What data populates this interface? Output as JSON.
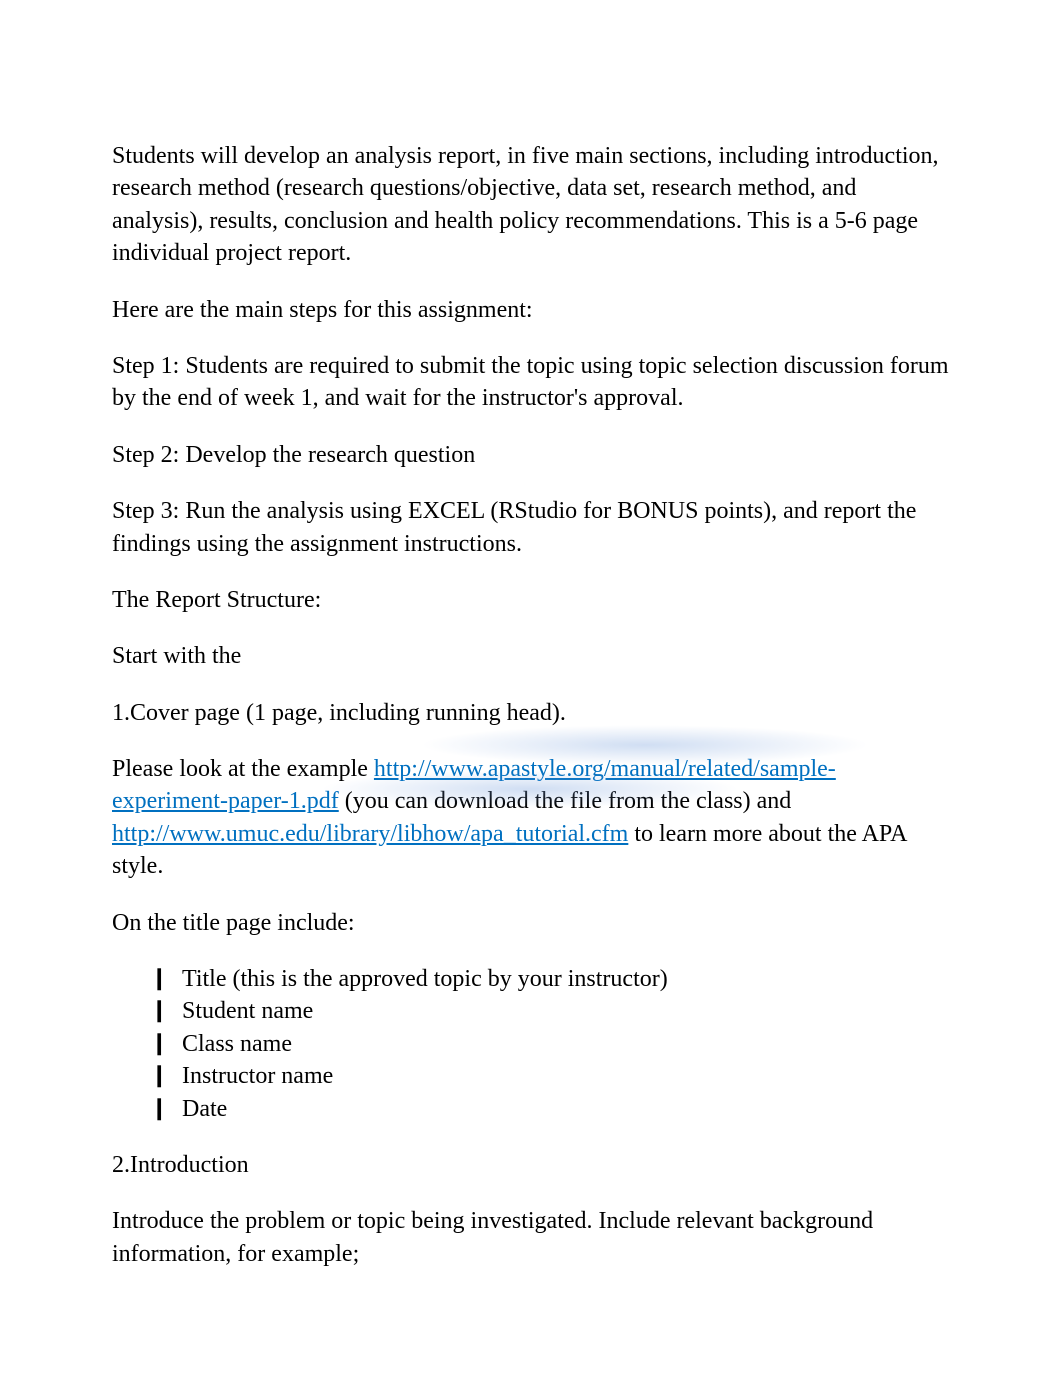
{
  "para1": {
    "part1": "Students will develop an analysis report, in five main sections, including  introduction, ",
    "part2": "research method (research questions/objective, data set, research method, and analysis), results, conclusion and ",
    "part3": "health policy recommendations",
    "part4": ". This is a 5-6 page individual project report."
  },
  "para2": "Here are the main steps for this assignment:",
  "step1": "Step 1:   Students are required to submit the topic using topic selection discussion forum by the end of week 1, and wait for the instructor's approval.",
  "step2": "Step 2:   Develop the research question",
  "step3": "Step 3:    Run the analysis using EXCEL (RStudio for BONUS points), and report the findings using the assignment instructions.",
  "reportStructure": "The Report Structure:",
  "startWith": "Start with the",
  "cover": {
    "num": "1.",
    "label": "Cover page",
    "rest": "    (1 page, including running head)."
  },
  "pleaseLook": {
    "p1": "Please look at the example  ",
    "link1": "http://www.apastyle.org/manual/related/sample-experiment-paper-1.pdf",
    "p2": "   (you can download the file from the class) and  ",
    "link2": "http://www.umuc.edu/library/libhow/apa_tutorial.cfm",
    "p3": "        to learn more about the APA style."
  },
  "onTitle": "On the title page include:",
  "bullets": {
    "b1": "Title (this is the approved topic by your instructor)",
    "b2": "Student name",
    "b3": "Class name",
    "b4": "Instructor name",
    "b5": "Date"
  },
  "intro": {
    "num": "2.",
    "label": "Introduction"
  },
  "introPara": "Introduce the problem or topic being investigated. Include relevant background information, for example;"
}
